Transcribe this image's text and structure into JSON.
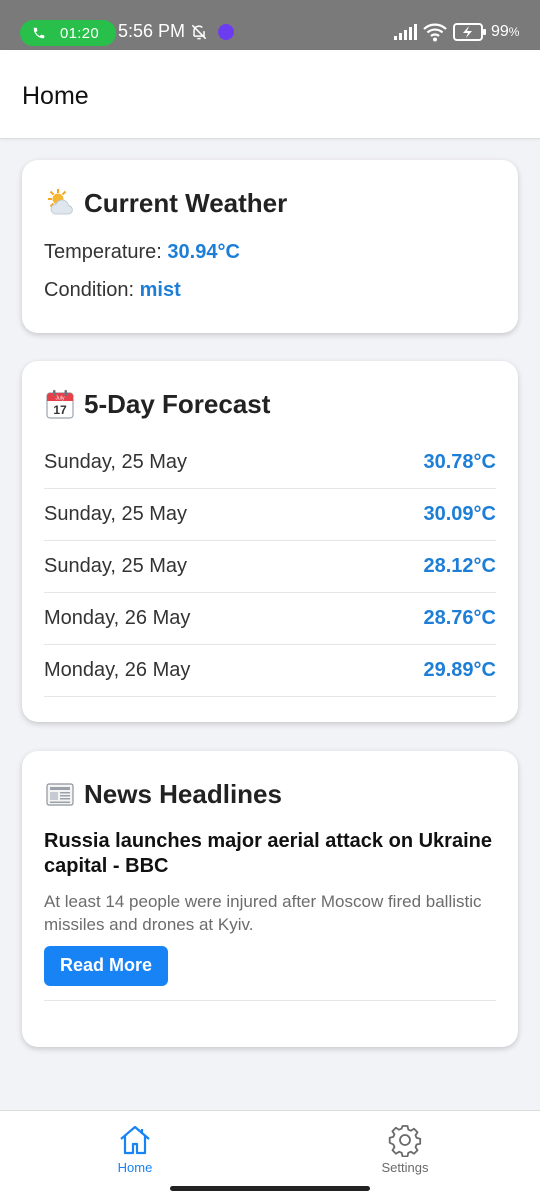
{
  "status_bar": {
    "call_timer": "01:20",
    "time": "5:56 PM",
    "battery": "99",
    "battery_unit": "%"
  },
  "app_bar": {
    "title": "Home"
  },
  "weather": {
    "heading": "Current Weather",
    "temperature_label": "Temperature: ",
    "temperature_value": "30.94°C",
    "condition_label": "Condition: ",
    "condition_value": "mist"
  },
  "forecast": {
    "heading": "5-Day Forecast",
    "rows": [
      {
        "day": "Sunday, 25 May",
        "temp": "30.78°C"
      },
      {
        "day": "Sunday, 25 May",
        "temp": "30.09°C"
      },
      {
        "day": "Sunday, 25 May",
        "temp": "28.12°C"
      },
      {
        "day": "Monday, 26 May",
        "temp": "28.76°C"
      },
      {
        "day": "Monday, 26 May",
        "temp": "29.89°C"
      }
    ]
  },
  "news": {
    "heading": "News Headlines",
    "items": [
      {
        "title": "Russia launches major aerial attack on Ukraine capital - BBC",
        "description": "At least 14 people were injured after Moscow fired ballistic missiles and drones at Kyiv.",
        "button_label": "Read More"
      }
    ]
  },
  "bottom_nav": {
    "items": [
      {
        "label": "Home",
        "icon": "home-icon",
        "active": true
      },
      {
        "label": "Settings",
        "icon": "gear-icon",
        "active": false
      }
    ]
  },
  "colors": {
    "accent": "#1783f5",
    "value_blue": "#1d7ed8",
    "call_green": "#28c04a",
    "status_bar": "#7a7a7a",
    "background": "#f2f3f7"
  }
}
